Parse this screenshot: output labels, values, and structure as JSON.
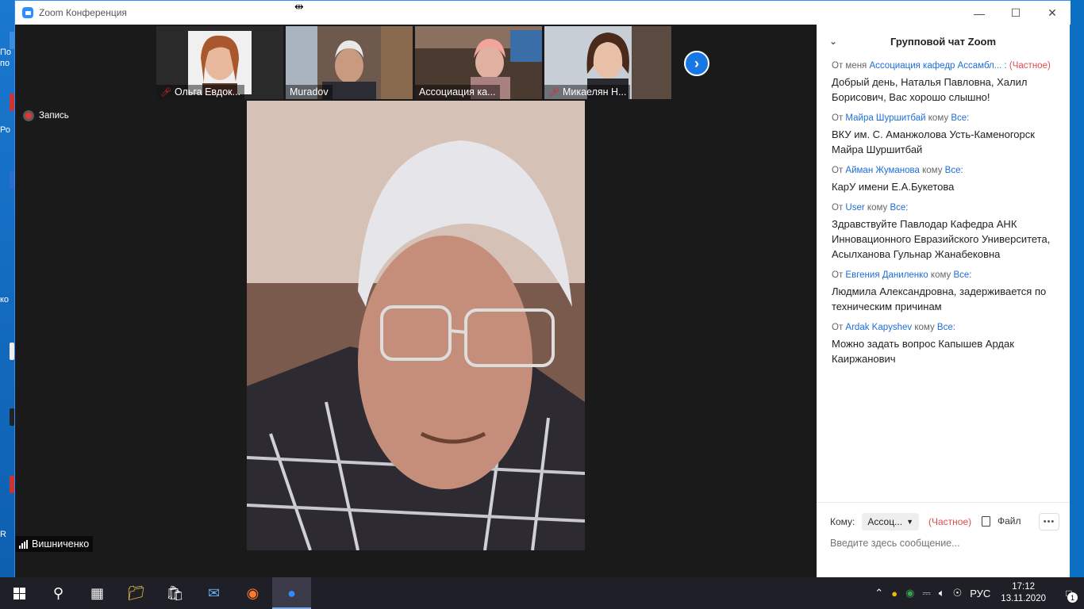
{
  "window": {
    "title": "Zoom Конференция"
  },
  "gallery": {
    "participants": [
      {
        "name": "Ольга Евдок...",
        "muted": true
      },
      {
        "name": "Muradov",
        "muted": false
      },
      {
        "name": "Ассоциация ка...",
        "muted": false
      },
      {
        "name": "Микаелян Н...",
        "muted": true
      }
    ]
  },
  "recording": {
    "label": "Запись"
  },
  "active_speaker": {
    "name": "Вишниченко"
  },
  "chat": {
    "title": "Групповой чат Zoom",
    "messages": [
      {
        "from_prefix": "От меня",
        "from": "Ассоциация кафедр Ассамбл... :",
        "to_prefix": "",
        "to": "",
        "private": "(Частное)",
        "text": "Добрый день, Наталья Павловна, Халил Борисович, Вас хорошо слышно!"
      },
      {
        "from_prefix": "От",
        "from": "Майра Шуршитбай",
        "to_prefix": "кому",
        "to": "Все:",
        "private": "",
        "text": "ВКУ им. С. Аманжолова Усть-Каменогорск Майра Шуршитбай"
      },
      {
        "from_prefix": "От",
        "from": "Айман Жуманова",
        "to_prefix": "кому",
        "to": "Все:",
        "private": "",
        "text": "КарУ имени Е.А.Букетова"
      },
      {
        "from_prefix": "От",
        "from": "User",
        "to_prefix": "кому",
        "to": "Все:",
        "private": "",
        "text": "Здравствуйте Павлодар Кафедра АНК Инновационного Евразийского Университета, Асылханова Гульнар Жанабековна"
      },
      {
        "from_prefix": "От",
        "from": "Евгения Даниленко",
        "to_prefix": "кому",
        "to": "Все:",
        "private": "",
        "text": "Людмила Александровна, задерживается по техническим причинам"
      },
      {
        "from_prefix": "От",
        "from": "Ardak Kapyshev",
        "to_prefix": "кому",
        "to": "Все:",
        "private": "",
        "text": "Можно задать вопрос Капышев Ардак Каиржанович"
      }
    ],
    "footer": {
      "to_label": "Кому:",
      "recipient": "Ассоц...",
      "private": "(Частное)",
      "file_label": "Файл",
      "input_placeholder": "Введите здесь сообщение..."
    }
  },
  "taskbar": {
    "language": "РУС",
    "time": "17:12",
    "date": "13.11.2020",
    "notifications": "1"
  },
  "colors": {
    "accent": "#2d8cff",
    "chat_name": "#1c6ed8",
    "private": "#e24b4b"
  }
}
